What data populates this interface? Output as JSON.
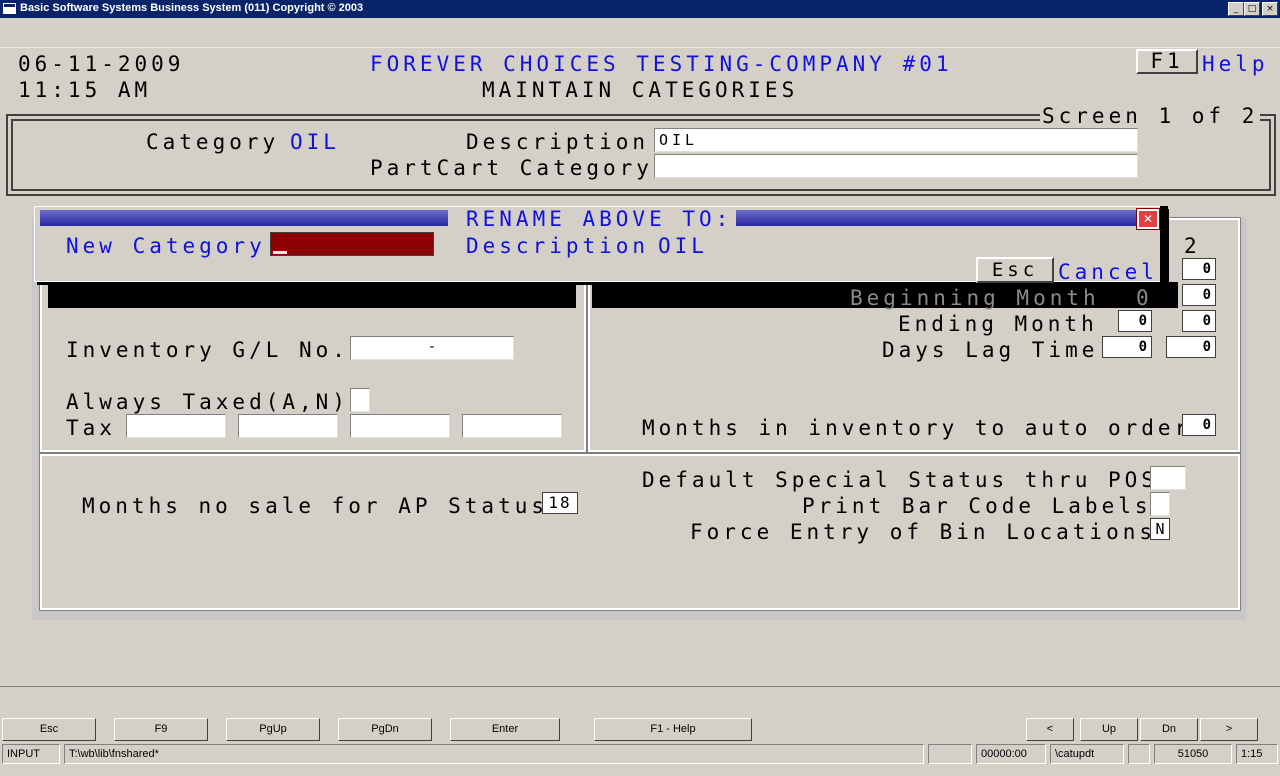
{
  "window": {
    "title": "Basic Software Systems Business System (011) Copyright © 2003",
    "min_glyph": "_",
    "max_glyph": "□",
    "close_glyph": "×"
  },
  "header": {
    "date": "06-11-2009",
    "time": "11:15 AM",
    "company": "FOREVER CHOICES TESTING-COMPANY #01",
    "screen_title": "MAINTAIN CATEGORIES",
    "f1_key": "F1",
    "help_label": "Help",
    "screen_indicator": "Screen 1 of 2"
  },
  "category_panel": {
    "category_label": "Category",
    "category_value": "OIL",
    "description_label": "Description",
    "description_value": "OIL",
    "partcart_label": "PartCart Category",
    "partcart_value": ""
  },
  "rename_dialog": {
    "title": "RENAME ABOVE TO:",
    "new_category_label": "New Category",
    "new_category_value": "",
    "description_label": "Description",
    "description_value": "OIL",
    "esc_key": "Esc",
    "cancel_label": "Cancel",
    "close_glyph": "✕"
  },
  "left_panel": {
    "inventory_gl_label": "Inventory G/L No.",
    "inventory_gl_value": "-",
    "always_taxed_label": "Always Taxed(A,N)",
    "always_taxed_value": "",
    "tax_label": "Tax",
    "tax_values": [
      "",
      "",
      "",
      ""
    ]
  },
  "right_panel": {
    "col2_header": "2",
    "beginning_month_label": "Beginning Month",
    "beginning_month_value": "0",
    "ending_month_label": "Ending Month",
    "days_lag_label": "Days Lag Time",
    "months_inventory_label": "Months in inventory to auto order",
    "row1_col2": "0",
    "beginning_col2": "0",
    "ending_col1": "0",
    "ending_col2": "0",
    "days_lag_col1": "0",
    "days_lag_col2": "0",
    "months_inventory_value": "0"
  },
  "bottom_panel": {
    "months_no_sale_label": "Months no sale for AP Status",
    "months_no_sale_value": "18",
    "default_special_label": "Default Special Status thru POS",
    "default_special_value": "",
    "print_bar_code_label": "Print Bar Code Labels",
    "print_bar_code_value": "",
    "force_entry_label": "Force Entry of Bin Locations",
    "force_entry_value": "N"
  },
  "function_bar": {
    "esc": "Esc",
    "f9": "F9",
    "pgup": "PgUp",
    "pgdn": "PgDn",
    "enter": "Enter",
    "f1_help": "F1 - Help",
    "left": "<",
    "up": "Up",
    "dn": "Dn",
    "right": ">"
  },
  "status_bar": {
    "mode": "INPUT",
    "path": "T:\\wb\\lib\\fnshared*",
    "blank1": "",
    "counter": "00000:00",
    "program": "\\catupdt",
    "blank2": "",
    "code": "51050",
    "clock": "1:15"
  }
}
